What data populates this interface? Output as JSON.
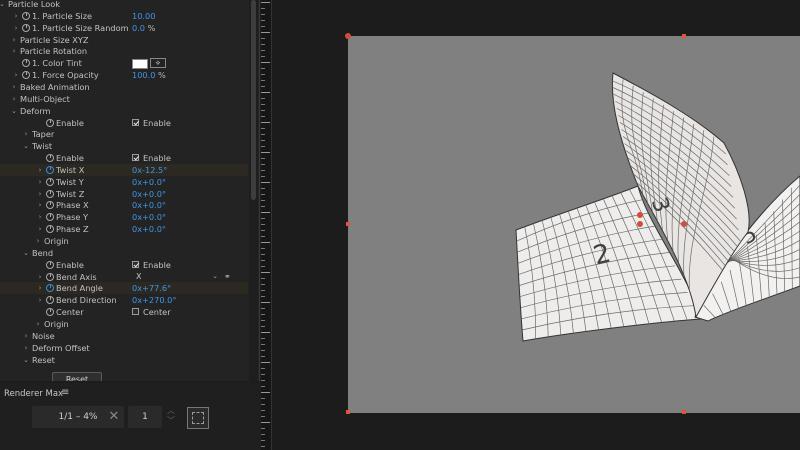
{
  "panel": {
    "rows": [
      {
        "label": "Particle Look",
        "kind": "group-open"
      },
      {
        "label": "1. Particle Size",
        "value": "10.00"
      },
      {
        "label": "1. Particle Size Random",
        "value": "0.0",
        "unit": "%"
      },
      {
        "label": "Particle Size XYZ"
      },
      {
        "label": "Particle Rotation"
      },
      {
        "label": "1. Color Tint",
        "kind": "color"
      },
      {
        "label": "1. Force Opacity",
        "value": "100.0",
        "unit": "%"
      },
      {
        "label": "Baked Animation"
      },
      {
        "label": "Multi-Object"
      },
      {
        "label": "Deform",
        "kind": "group-open"
      },
      {
        "label": "Enable",
        "checkbox": "Enable"
      },
      {
        "label": "Taper"
      },
      {
        "label": "Twist",
        "kind": "group-open"
      },
      {
        "label": "Enable",
        "checkbox": "Enable"
      },
      {
        "label": "Twist X",
        "value": "0x-12.5°",
        "keyed": true
      },
      {
        "label": "Twist Y",
        "value": "0x+0.0°"
      },
      {
        "label": "Twist Z",
        "value": "0x+0.0°"
      },
      {
        "label": "Phase X",
        "value": "0x+0.0°"
      },
      {
        "label": "Phase Y",
        "value": "0x+0.0°"
      },
      {
        "label": "Phase Z",
        "value": "0x+0.0°"
      },
      {
        "label": "Origin"
      },
      {
        "label": "Bend",
        "kind": "group-open"
      },
      {
        "label": "Enable",
        "checkbox": "Enable"
      },
      {
        "label": "Bend Axis",
        "dropdown": "X"
      },
      {
        "label": "Bend Angle",
        "value": "0x+77.6°",
        "keyed": true
      },
      {
        "label": "Bend Direction",
        "value": "0x+270.0°"
      },
      {
        "label": "Center",
        "checkbox": "Center",
        "unchecked": true
      },
      {
        "label": "Origin"
      },
      {
        "label": "Noise"
      },
      {
        "label": "Deform Offset"
      },
      {
        "label": "Reset",
        "kind": "group-open"
      }
    ],
    "reset_button": "Reset"
  },
  "renderer": {
    "title": "Renderer Max",
    "menu_icon": "hamburger-menu-icon",
    "resolution": "1/1 – 4%",
    "frame": "1"
  },
  "viewport": {
    "tile_labels": [
      "2",
      "3",
      "5"
    ],
    "background": "#808080",
    "handle_color": "#e2533c"
  }
}
